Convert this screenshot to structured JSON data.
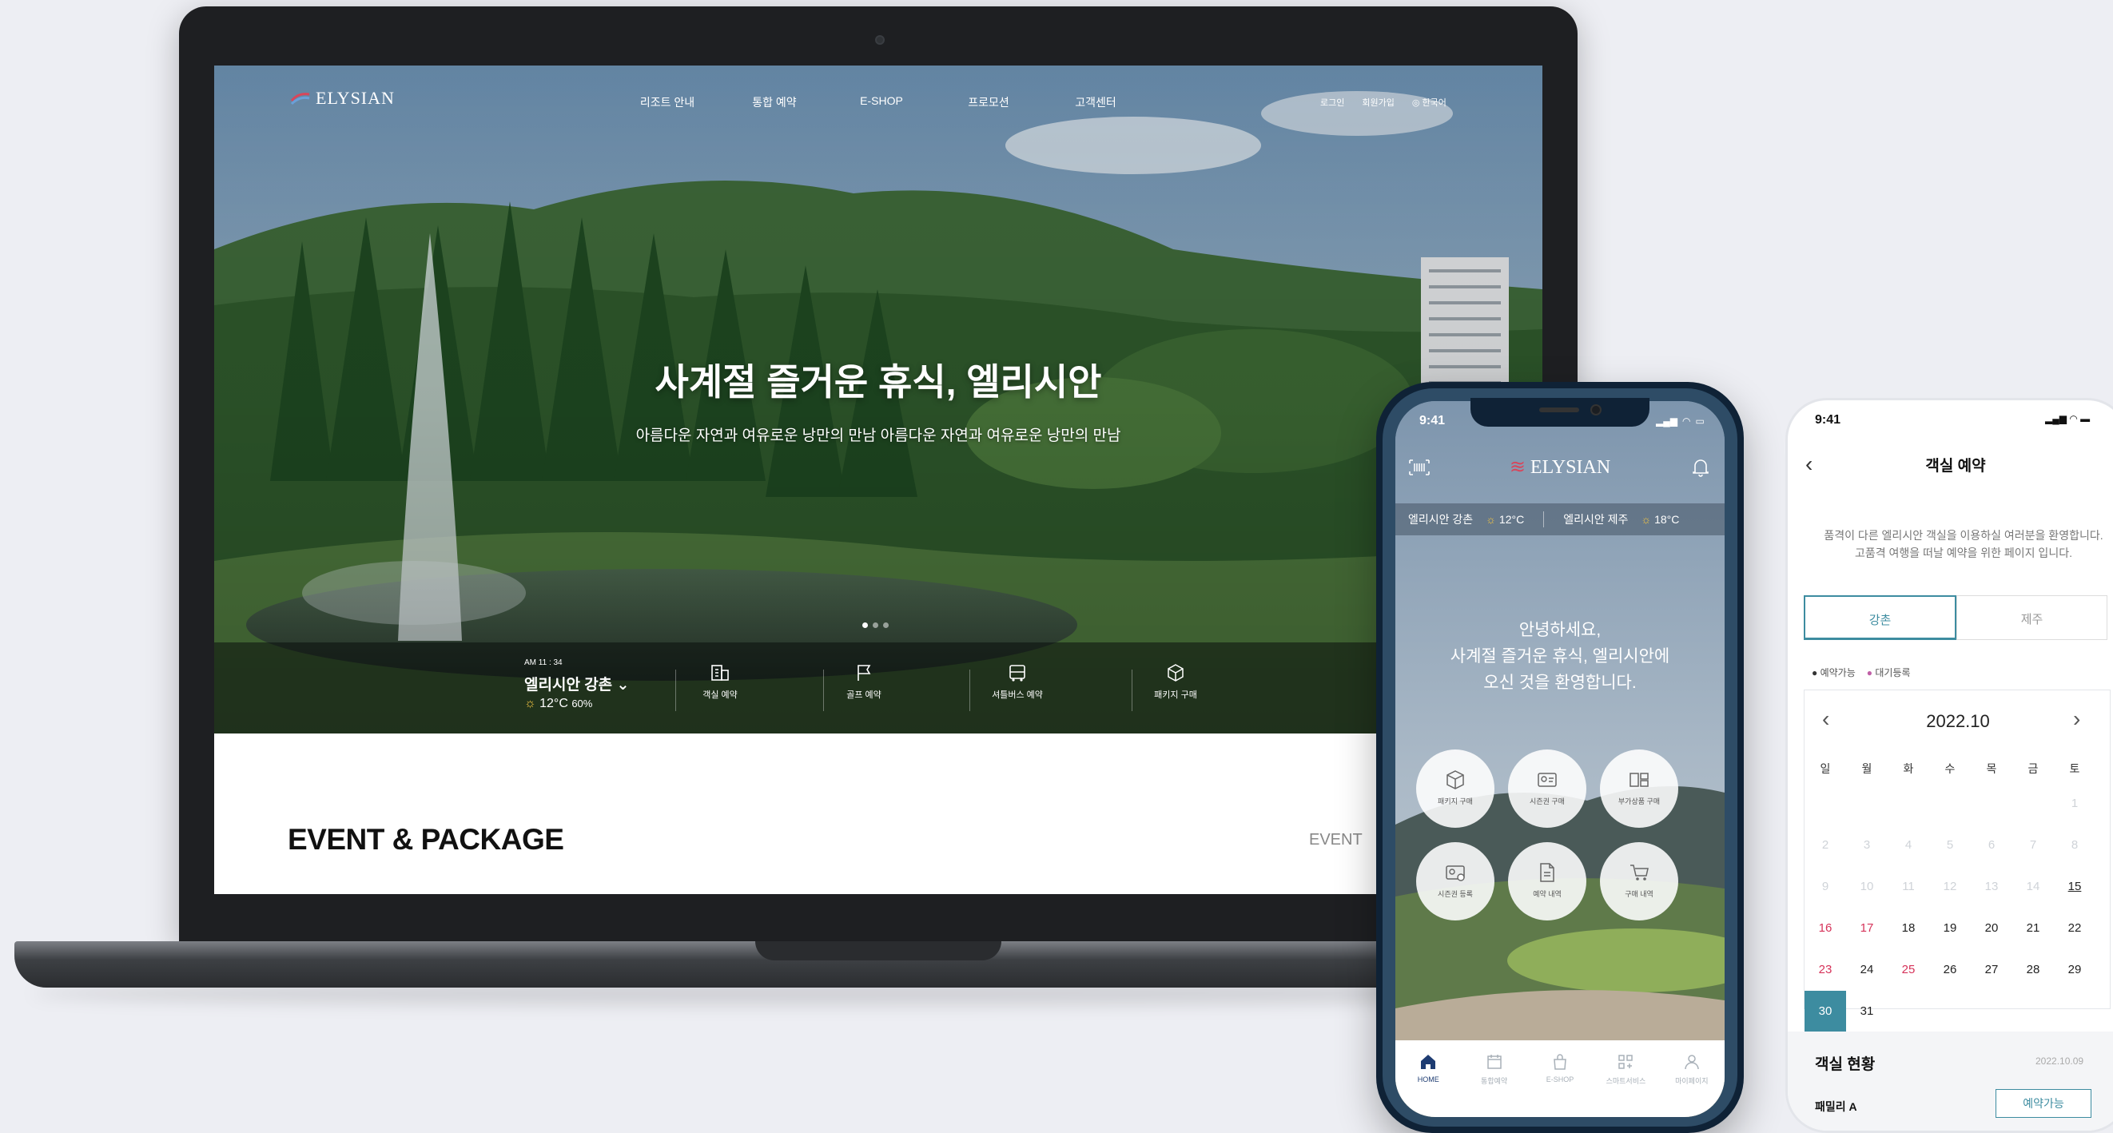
{
  "laptop": {
    "brand": "ELYSIAN",
    "nav": [
      "리조트 안내",
      "통합 예약",
      "E-SHOP",
      "프로모션",
      "고객센터"
    ],
    "util": [
      "로그인",
      "회원가입",
      "한국어"
    ],
    "hero_title": "사계절 즐거운 휴식, 엘리시안",
    "hero_sub": "아름다운 자연과 여유로운 낭만의 만남 아름다운 자연과 여유로운 낭만의 만남",
    "slide_count": 3,
    "time": "AM 11 : 34",
    "resort": "엘리시안 강촌 ⌄",
    "temp": "12°C",
    "humidity": "60%",
    "quick": [
      "객실 예약",
      "골프 예약",
      "셔틀버스 예약",
      "패키지 구매"
    ],
    "event_title": "EVENT & PACKAGE",
    "event_tab": "EVENT"
  },
  "phone1": {
    "time": "9:41",
    "brand": "ELYSIAN",
    "weather1_name": "엘리시안 강촌",
    "weather1_temp": "12°C",
    "weather2_name": "엘리시안 제주",
    "weather2_temp": "18°C",
    "greeting": [
      "안녕하세요,",
      "사계절 즐거운 휴식, 엘리시안에",
      "오신 것을 환영합니다."
    ],
    "circles": [
      "패키지 구매",
      "시즌권 구매",
      "부가상품 구매",
      "시즌권 등록",
      "예약 내역",
      "구매 내역"
    ],
    "tabs": [
      "HOME",
      "통합예약",
      "E-SHOP",
      "스마트서비스",
      "마이페이지"
    ]
  },
  "phone2": {
    "time": "9:41",
    "title": "객실 예약",
    "intro": [
      "품격이 다른 엘리시안 객실을 이용하실 여러분을 환영합니다.",
      "고품격 여행을 떠날 예약을 위한 페이지 입니다."
    ],
    "tabs": [
      "강촌",
      "제주"
    ],
    "legend": [
      "예약가능",
      "대기등록"
    ],
    "month": "2022.10",
    "weekdays": [
      "일",
      "월",
      "화",
      "수",
      "목",
      "금",
      "토"
    ],
    "status_title": "객실 현황",
    "status_date": "2022.10.09",
    "room_name": "패밀리 A",
    "room_button": "예약가능"
  },
  "colors": {
    "accent": "#3d8ca0",
    "sunday": "#d6335a",
    "waitlist": "#c05fa6",
    "active_tab": "#1e3c72"
  }
}
